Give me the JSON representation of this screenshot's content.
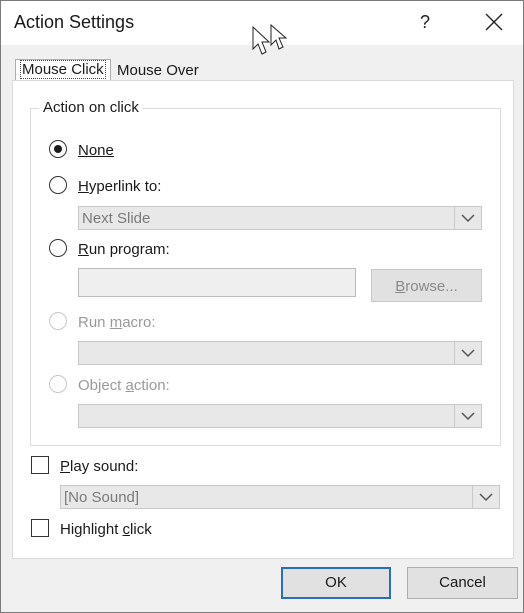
{
  "dialog": {
    "title": "Action Settings",
    "help": "?",
    "close_icon": "close-icon"
  },
  "tabs": [
    {
      "label": "Mouse Click",
      "active": true
    },
    {
      "label": "Mouse Over",
      "active": false
    }
  ],
  "group": {
    "label": "Action on click",
    "none": {
      "label": "None",
      "checked": true
    },
    "hyperlink": {
      "label_u": "H",
      "label_rest": "yperlink to:",
      "value": "Next Slide"
    },
    "run_program": {
      "label_u": "R",
      "label_rest": "un program:",
      "value": "",
      "browse_u": "B",
      "browse_rest": "rowse..."
    },
    "run_macro": {
      "label_pre": "Run ",
      "label_u": "m",
      "label_rest": "acro:",
      "value": ""
    },
    "object_action": {
      "label_pre": "Object ",
      "label_u": "a",
      "label_rest": "ction:",
      "value": ""
    }
  },
  "play_sound": {
    "label_u": "P",
    "label_rest": "lay sound:",
    "checked": false,
    "value": "[No Sound]"
  },
  "highlight_click": {
    "label_pre": "Highlight ",
    "label_u": "c",
    "label_rest": "lick",
    "checked": false
  },
  "buttons": {
    "ok": "OK",
    "cancel": "Cancel"
  }
}
